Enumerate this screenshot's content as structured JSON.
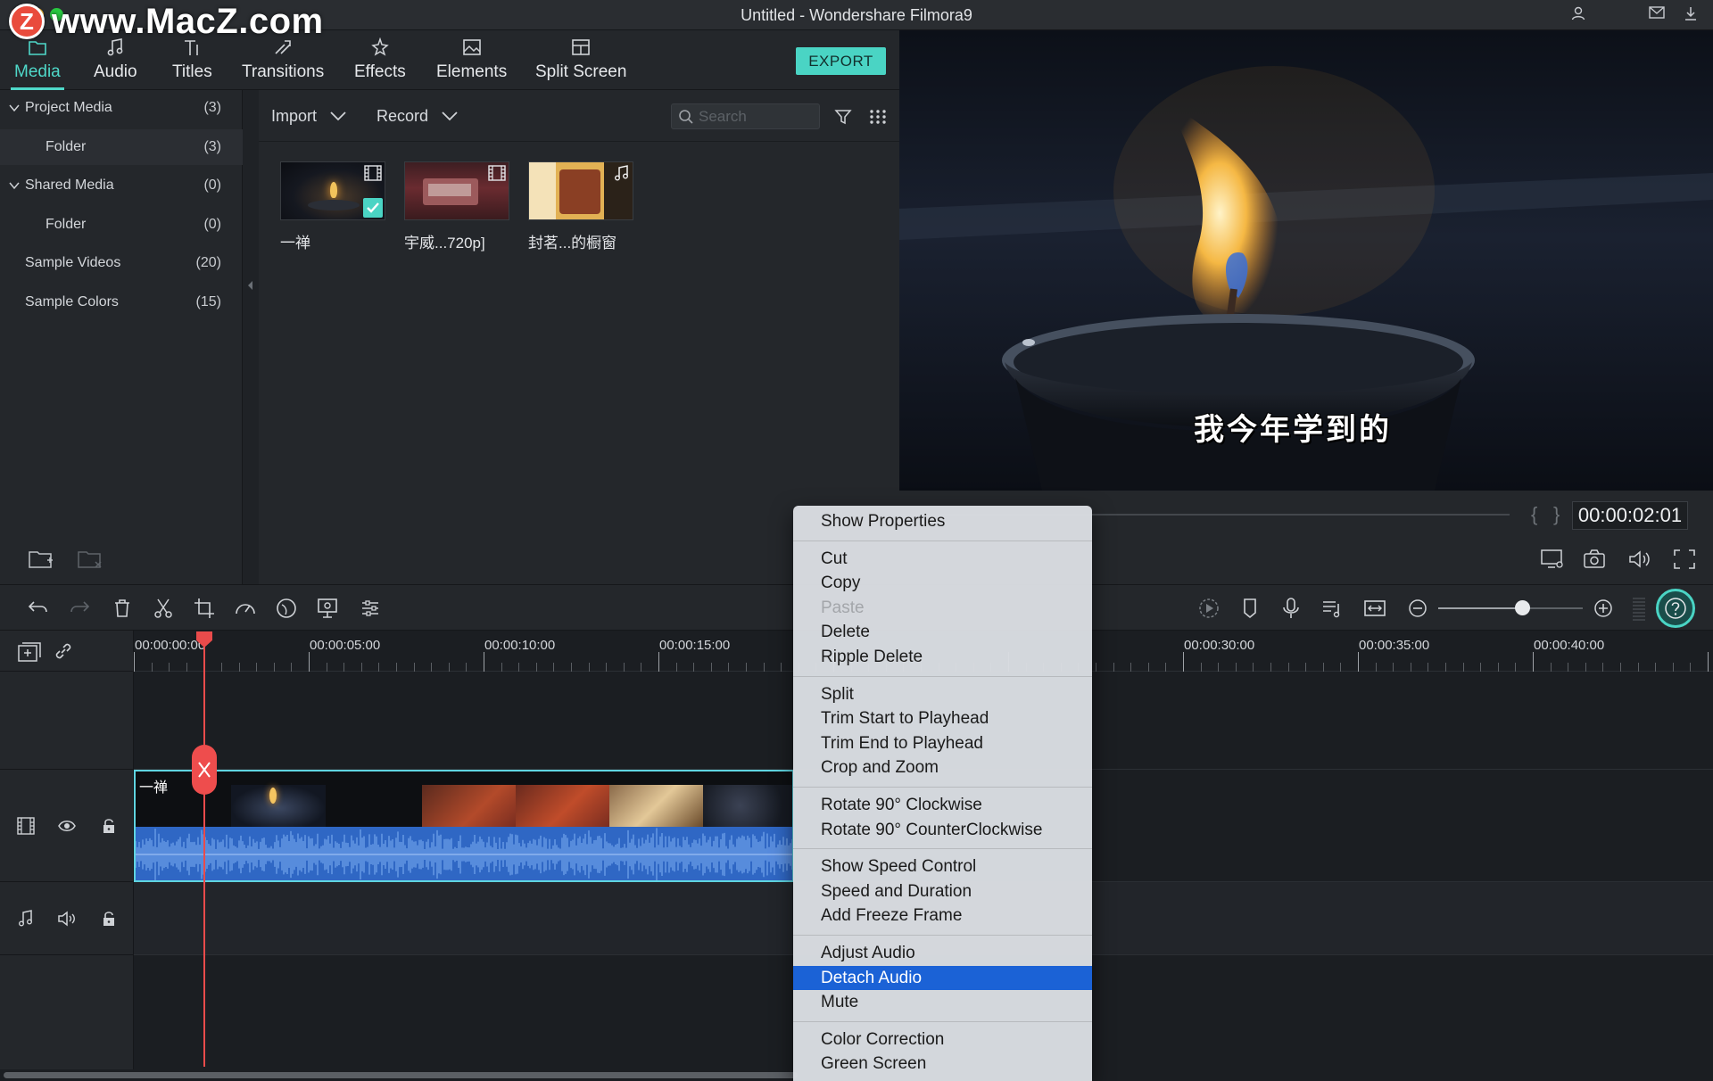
{
  "window": {
    "title": "Untitled - Wondershare Filmora9",
    "watermark": "www.MacZ.com",
    "watermark_logo": "Z"
  },
  "tabs": [
    {
      "label": "Media",
      "icon": "folder-icon",
      "active": true
    },
    {
      "label": "Audio",
      "icon": "music-note-icon",
      "active": false
    },
    {
      "label": "Titles",
      "icon": "titles-icon",
      "active": false
    },
    {
      "label": "Transitions",
      "icon": "transition-icon",
      "active": false
    },
    {
      "label": "Effects",
      "icon": "effects-icon",
      "active": false
    },
    {
      "label": "Elements",
      "icon": "image-icon",
      "active": false
    },
    {
      "label": "Split Screen",
      "icon": "split-screen-icon",
      "active": false
    }
  ],
  "export_label": "EXPORT",
  "library": [
    {
      "label": "Project Media",
      "count": "(3)",
      "expandable": true
    },
    {
      "label": "Folder",
      "count": "(3)",
      "expandable": false
    },
    {
      "label": "Shared Media",
      "count": "(0)",
      "expandable": true
    },
    {
      "label": "Folder",
      "count": "(0)",
      "expandable": false
    },
    {
      "label": "Sample Videos",
      "count": "(20)",
      "expandable": false
    },
    {
      "label": "Sample Colors",
      "count": "(15)",
      "expandable": false
    }
  ],
  "media_toolbar": {
    "import_label": "Import",
    "record_label": "Record",
    "search_placeholder": "Search"
  },
  "media_items": [
    {
      "label": "一禅",
      "type": "video",
      "selected": true
    },
    {
      "label": "宇威...720p]",
      "type": "video",
      "selected": false
    },
    {
      "label": "封茗...的橱窗",
      "type": "audio",
      "selected": false
    }
  ],
  "preview": {
    "subtitle": "我今年学到的",
    "timecode": "00:00:02:01"
  },
  "ruler": {
    "labels": [
      "00:00:00:00",
      "00:00:05:00",
      "00:00:10:00",
      "00:00:15:00",
      "00:00:30:00",
      "00:00:35:00",
      "00:00:40:00"
    ]
  },
  "clip": {
    "title": "一禅"
  },
  "zoom_level": 0.58,
  "context_menu": {
    "groups": [
      [
        {
          "label": "Show Properties"
        }
      ],
      [
        {
          "label": "Cut"
        },
        {
          "label": "Copy"
        },
        {
          "label": "Paste",
          "disabled": true
        },
        {
          "label": "Delete"
        },
        {
          "label": "Ripple Delete"
        }
      ],
      [
        {
          "label": "Split"
        },
        {
          "label": "Trim Start to Playhead"
        },
        {
          "label": "Trim End to Playhead"
        },
        {
          "label": "Crop and Zoom"
        }
      ],
      [
        {
          "label": "Rotate 90° Clockwise"
        },
        {
          "label": "Rotate 90° CounterClockwise"
        }
      ],
      [
        {
          "label": "Show Speed Control"
        },
        {
          "label": "Speed and Duration"
        },
        {
          "label": "Add Freeze Frame"
        }
      ],
      [
        {
          "label": "Adjust Audio"
        },
        {
          "label": "Detach Audio",
          "highlighted": true
        },
        {
          "label": "Mute"
        }
      ],
      [
        {
          "label": "Color Correction"
        },
        {
          "label": "Green Screen"
        }
      ]
    ]
  },
  "colors": {
    "accent": "#4ad4c4",
    "playhead": "#e94b4b",
    "menu_highlight": "#1b62d6",
    "audio_wave": "#2f67c4"
  }
}
